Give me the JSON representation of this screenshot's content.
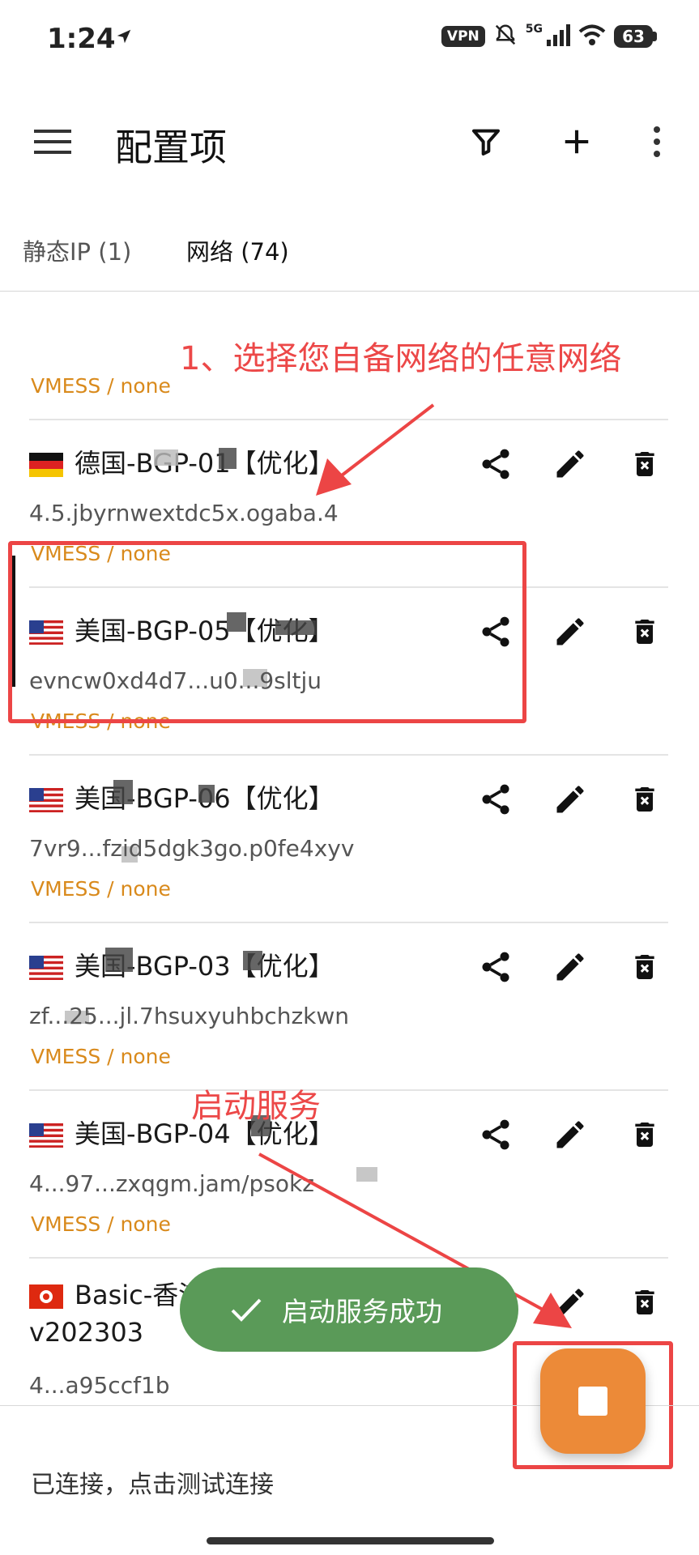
{
  "status_bar": {
    "time": "1:24",
    "vpn_label": "VPN",
    "network_label": "5G",
    "battery": "63"
  },
  "toolbar": {
    "title": "配置项",
    "menu_icon": "menu-icon",
    "filter_icon": "filter-icon",
    "add_icon": "add-icon",
    "more_icon": "more-vert-icon"
  },
  "tabs": [
    {
      "label": "静态IP (1)",
      "selected": false
    },
    {
      "label": "网络 (74)",
      "selected": true
    }
  ],
  "servers": [
    {
      "flag": "de",
      "name": "德国-BGP-01【优化】",
      "address": "4.5.jbyrnwextdc5x.ogaba.4",
      "type": "VMESS / none",
      "selected": false
    },
    {
      "flag": "us",
      "name": "美国-BGP-05【优化】",
      "address": "evncw0xd4d7...u0...9sltju",
      "type": "VMESS / none",
      "selected": true
    },
    {
      "flag": "us",
      "name": "美国-BGP-06【优化】",
      "address": "7vr9...fzid5dgk3go.p0fe4xyv",
      "type": "VMESS / none",
      "selected": false
    },
    {
      "flag": "us",
      "name": "美国-BGP-03【优化】",
      "address": "zf...25...jl.7hsuxyuhbchzkwn",
      "type": "VMESS / none",
      "selected": false
    },
    {
      "flag": "us",
      "name": "美国-BGP-04【优化】",
      "address": "4...97...zxqgm.jam/psokz",
      "type": "VMESS / none",
      "selected": false
    },
    {
      "flag": "hk",
      "name": "Basic-香港-BGP-01|",
      "name_line2": "v202303",
      "address": "4...a95ccf1b",
      "type": "VMESS / none",
      "selected": false
    }
  ],
  "partial_top_item": {
    "type": "VMESS / none"
  },
  "annotations": {
    "step1": "1、选择您自备网络的任意网络",
    "start_service": "启动服务"
  },
  "toast": {
    "text": "启动服务成功",
    "icon": "check-icon"
  },
  "fab": {
    "icon": "stop-icon",
    "color": "#ec8a38"
  },
  "bottom": {
    "status_text": "已连接，点击测试连接"
  },
  "colors": {
    "accent_orange": "#ec8a38",
    "type_text": "#d98a1c",
    "toast_green": "#5a9a58",
    "annotation_red": "#ec4545"
  }
}
